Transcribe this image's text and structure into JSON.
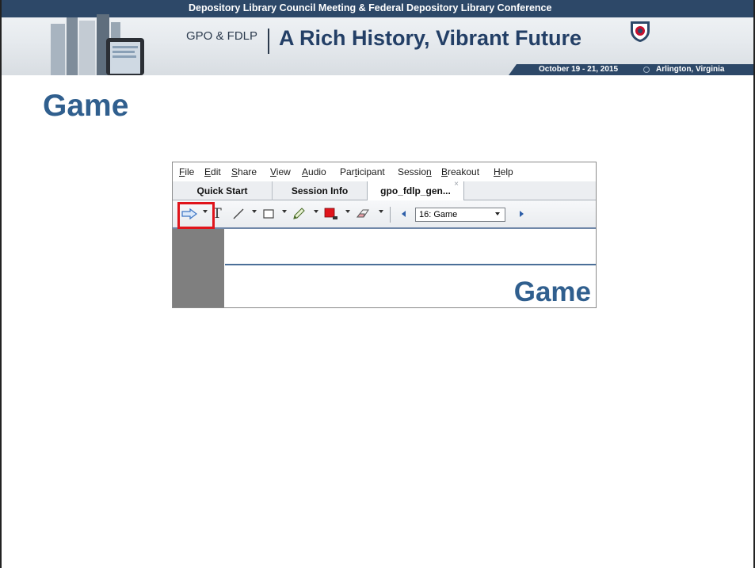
{
  "banner": {
    "conference": "Depository Library Council Meeting & Federal Depository Library Conference",
    "org": "GPO & FDLP",
    "tagline": "A Rich History, Vibrant Future",
    "dates": "October 19 - 21, 2015",
    "location": "Arlington, Virginia"
  },
  "slide": {
    "title": "Game"
  },
  "app": {
    "menu": [
      {
        "pre": "",
        "u": "F",
        "post": "ile"
      },
      {
        "pre": "",
        "u": "E",
        "post": "dit"
      },
      {
        "pre": "",
        "u": "S",
        "post": "hare"
      },
      {
        "pre": "",
        "u": "V",
        "post": "iew"
      },
      {
        "pre": "",
        "u": "A",
        "post": "udio"
      },
      {
        "pre": "Par",
        "u": "t",
        "post": "icipant"
      },
      {
        "pre": "Sessio",
        "u": "n",
        "post": ""
      },
      {
        "pre": "",
        "u": "B",
        "post": "reakout"
      },
      {
        "pre": "",
        "u": "H",
        "post": "elp"
      }
    ],
    "tabs": [
      "Quick Start",
      "Session Info",
      "gpo_fdlp_gen..."
    ],
    "tab_close": "×",
    "toolbar": {
      "text_tool": "T",
      "slide_selector": "16: Game"
    },
    "canvas_title": "Game"
  },
  "colors": {
    "title_blue": "#305f8e",
    "banner_navy": "#2d4868",
    "highlight_red": "#e0141b"
  }
}
